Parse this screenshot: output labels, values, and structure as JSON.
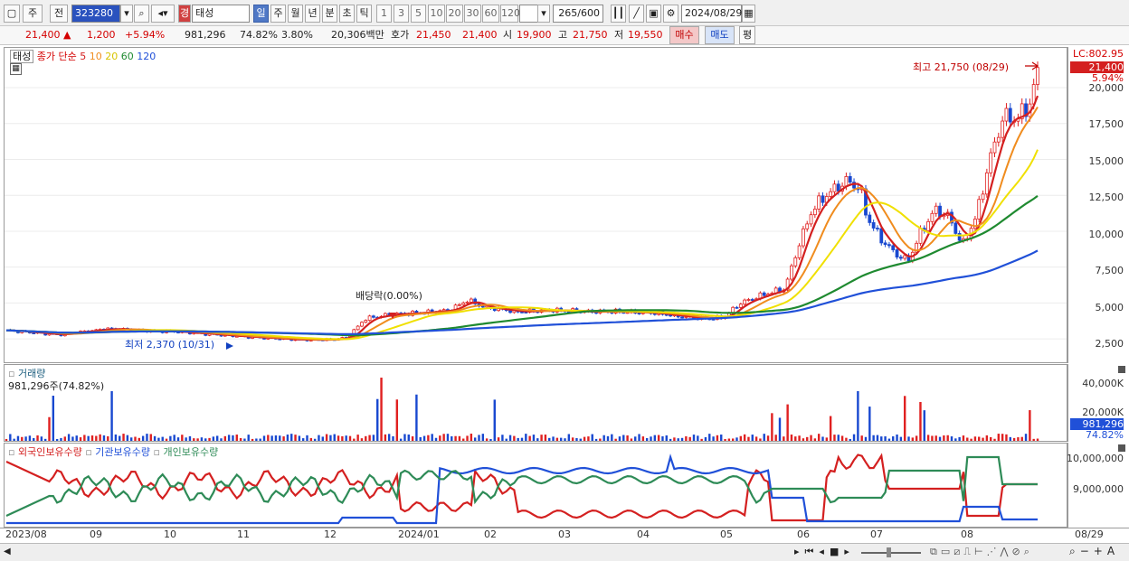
{
  "toolbar": {
    "market_btn": "주",
    "prev_btn": "전",
    "code": "323280",
    "type_badge": "경",
    "name": "태성",
    "periods": [
      "일",
      "주",
      "월",
      "년",
      "분",
      "초",
      "틱"
    ],
    "minutes": [
      "1",
      "3",
      "5",
      "10",
      "20",
      "30",
      "60",
      "120"
    ],
    "count": "265",
    "count_total": "/600",
    "date": "2024/08/29"
  },
  "quote": {
    "price": "21,400",
    "change": "1,200",
    "pct": "+5.94%",
    "volume": "981,296",
    "vol_ratio": "74.82%",
    "turnover": "3.80%",
    "amount": "20,306백만",
    "ask_label": "호가",
    "ask": "21,450",
    "bid": "21,400",
    "open_label": "시",
    "open": "19,900",
    "high_label": "고",
    "high": "21,750",
    "low_label": "저",
    "low": "19,550",
    "buy_btn": "매수",
    "sell_btn": "매도",
    "eval_btn": "평"
  },
  "price_chart": {
    "stock_label": "태성",
    "ma_label": "종가 단순",
    "ma_periods": [
      "5",
      "10",
      "20",
      "60",
      "120"
    ],
    "ma_colors": [
      "#d42020",
      "#f08c1e",
      "#f0e000",
      "#1f8a30",
      "#2050d8"
    ],
    "lc_label": "LC:802.95",
    "last_price": "21,400",
    "last_pct": "5.94%",
    "high_note": "최고 21,750 (08/29)",
    "low_note": "최저 2,370 (10/31)",
    "dividend_note": "배당락(0.00%)",
    "y_ticks": [
      "20,000",
      "17,500",
      "15,000",
      "12,500",
      "10,000",
      "7,500",
      "5,000",
      "2,500"
    ]
  },
  "volume_chart": {
    "title": "거래량",
    "current": "981,296주(74.82%)",
    "y_ticks": [
      "40,000K",
      "20,000K"
    ],
    "last_value": "981,296",
    "last_pct": "74.82%"
  },
  "holding_chart": {
    "legend": [
      "외국인보유수량",
      "기관보유수량",
      "개인보유수량"
    ],
    "legend_colors": [
      "#d42020",
      "#2050d8",
      "#2e8b57"
    ],
    "y_ticks": [
      "10,000,000",
      "9,000,000"
    ]
  },
  "x_axis": {
    "labels": [
      "2023/08",
      "09",
      "10",
      "11",
      "12",
      "2024/01",
      "02",
      "03",
      "04",
      "05",
      "06",
      "07",
      "08"
    ],
    "last_date": "08/29"
  }
}
